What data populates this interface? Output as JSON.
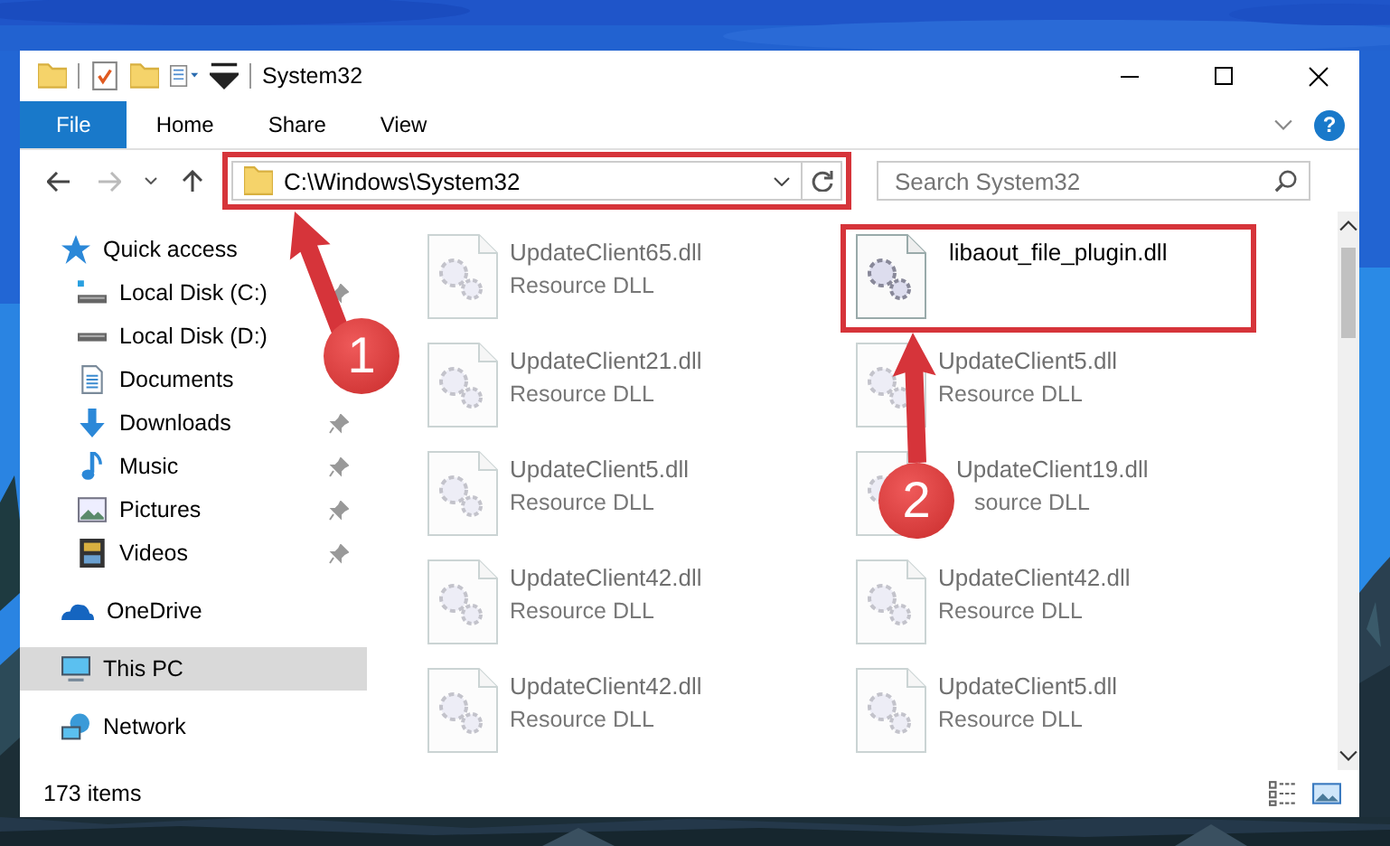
{
  "window": {
    "title": "System32"
  },
  "ribbon": {
    "tabs": [
      {
        "label": "File",
        "selected": true
      },
      {
        "label": "Home",
        "selected": false
      },
      {
        "label": "Share",
        "selected": false
      },
      {
        "label": "View",
        "selected": false
      }
    ],
    "help": "?"
  },
  "address": {
    "path": "C:\\Windows\\System32",
    "framed": true,
    "search_placeholder": "Search System32"
  },
  "sidebar": {
    "items": [
      {
        "label": "Quick access",
        "kind": "quick",
        "pinned": false,
        "selected": false
      },
      {
        "label": "Local Disk (C:)",
        "kind": "drive-c",
        "pinned": true,
        "selected": false
      },
      {
        "label": "Local Disk (D:)",
        "kind": "drive",
        "pinned": false,
        "selected": false
      },
      {
        "label": "Documents",
        "kind": "documents",
        "pinned": false,
        "selected": false
      },
      {
        "label": "Downloads",
        "kind": "downloads",
        "pinned": true,
        "selected": false
      },
      {
        "label": "Music",
        "kind": "music",
        "pinned": true,
        "selected": false
      },
      {
        "label": "Pictures",
        "kind": "pictures",
        "pinned": true,
        "selected": false
      },
      {
        "label": "Videos",
        "kind": "videos",
        "pinned": true,
        "selected": false
      },
      {
        "label": "OneDrive",
        "kind": "onedrive",
        "pinned": false,
        "selected": false
      },
      {
        "label": "This PC",
        "kind": "pc",
        "pinned": false,
        "selected": true
      },
      {
        "label": "Network",
        "kind": "network",
        "pinned": false,
        "selected": false
      }
    ]
  },
  "files": [
    {
      "name": "UpdateClient65.dll",
      "type": "Resource DLL",
      "blurred": true,
      "framed": false,
      "covered": false
    },
    {
      "name": "libaout_file_plugin.dll",
      "blurred": false,
      "framed": true,
      "covered": false
    },
    {
      "name": "UpdateClient21.dll",
      "type": "Resource DLL",
      "blurred": true,
      "framed": false,
      "covered": false
    },
    {
      "name": "UpdateClient5.dll",
      "type": "Resource DLL",
      "blurred": true,
      "framed": false,
      "covered": false
    },
    {
      "name": "UpdateClient5.dll",
      "type": "Resource DLL",
      "blurred": true,
      "framed": false,
      "covered": false
    },
    {
      "name": "UpdateClient19.dll",
      "type": "source DLL",
      "blurred": true,
      "framed": false,
      "covered": true
    },
    {
      "name": "UpdateClient42.dll",
      "type": "Resource DLL",
      "blurred": true,
      "framed": false,
      "covered": false
    },
    {
      "name": "UpdateClient42.dll",
      "type": "Resource DLL",
      "blurred": true,
      "framed": false,
      "covered": false
    },
    {
      "name": "UpdateClient42.dll",
      "type": "Resource DLL",
      "blurred": true,
      "framed": false,
      "covered": false
    },
    {
      "name": "UpdateClient5.dll",
      "type": "Resource DLL",
      "blurred": true,
      "framed": false,
      "covered": false
    }
  ],
  "status_bar": {
    "count": "173 items"
  },
  "annotations": [
    {
      "label": "1"
    },
    {
      "label": "2"
    }
  ]
}
